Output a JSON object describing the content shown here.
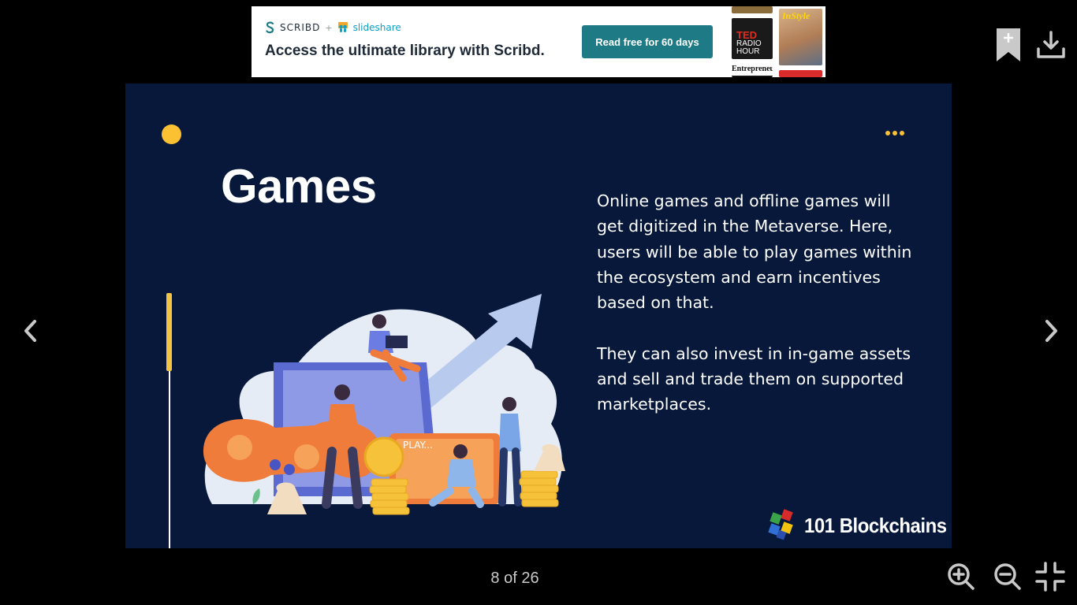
{
  "ad": {
    "brand_scribd": "SCRIBD",
    "brand_plus": "+",
    "brand_slideshare": "slideshare",
    "headline": "Access the ultimate library with Scribd.",
    "cta_label": "Read free for 60 days",
    "cta_color": "#1e7b85",
    "magazines": {
      "ted_title": "TED",
      "ted_subtitle_line1": "RADIO",
      "ted_subtitle_line2": "HOUR",
      "instyle_title": "InStyle",
      "entrepreneur_title": "Entrepreneur"
    }
  },
  "toolbar": {
    "bookmark_icon": "bookmark-add-icon",
    "download_icon": "download-icon"
  },
  "navigation": {
    "prev_icon": "chevron-left-icon",
    "next_icon": "chevron-right-icon"
  },
  "slide": {
    "title": "Games",
    "paragraphs": [
      "Online games and offline games will get digitized in the Metaverse. Here, users will be able to play games within the ecosystem and earn incentives based on that.",
      "They can also invest in in-game assets and sell and trade them on supported marketplaces."
    ],
    "illustration_label": "PLAY...",
    "brand_name": "101 Blockchains",
    "colors": {
      "background": "#07183a",
      "accent": "#fcc133"
    }
  },
  "footer": {
    "page_indicator": "8 of 26",
    "zoom_in_icon": "zoom-in-icon",
    "zoom_out_icon": "zoom-out-icon",
    "collapse_icon": "collapse-fullscreen-icon"
  }
}
